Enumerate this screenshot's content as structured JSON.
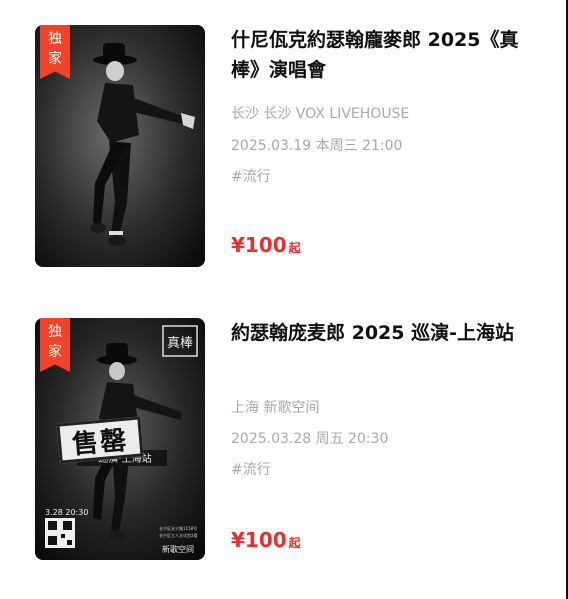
{
  "shows": [
    {
      "badge": [
        "独",
        "家"
      ],
      "title": "什尼佤克約瑟翰龐麥郎 2025《真棒》演唱會",
      "venue": "长沙 长沙 VOX LIVEHOUSE",
      "datetime": "2025.03.19 本周三 21:00",
      "tag": "#流行",
      "price": "¥100",
      "price_suffix": "起"
    },
    {
      "badge": [
        "独",
        "家"
      ],
      "title": "約瑟翰庞麦郎 2025 巡演-上海站",
      "venue": "上海 新歌空间",
      "datetime": "2025.03.28 周五 20:30",
      "tag": "#流行",
      "price": "¥100",
      "price_suffix": "起",
      "stamp": "售罄",
      "poster_text": {
        "logo": "真棒",
        "date": "3.28 20:30",
        "venue": "新歌空间",
        "subtitle": "巡演·上海站",
        "address": [
          "长宁区长宁路1158号",
          "长宁区工人文化宫2楼"
        ]
      }
    }
  ],
  "colors": {
    "accent": "#ef2d2d",
    "ribbon": "#f0432a",
    "meta": "#a9a9a9"
  }
}
